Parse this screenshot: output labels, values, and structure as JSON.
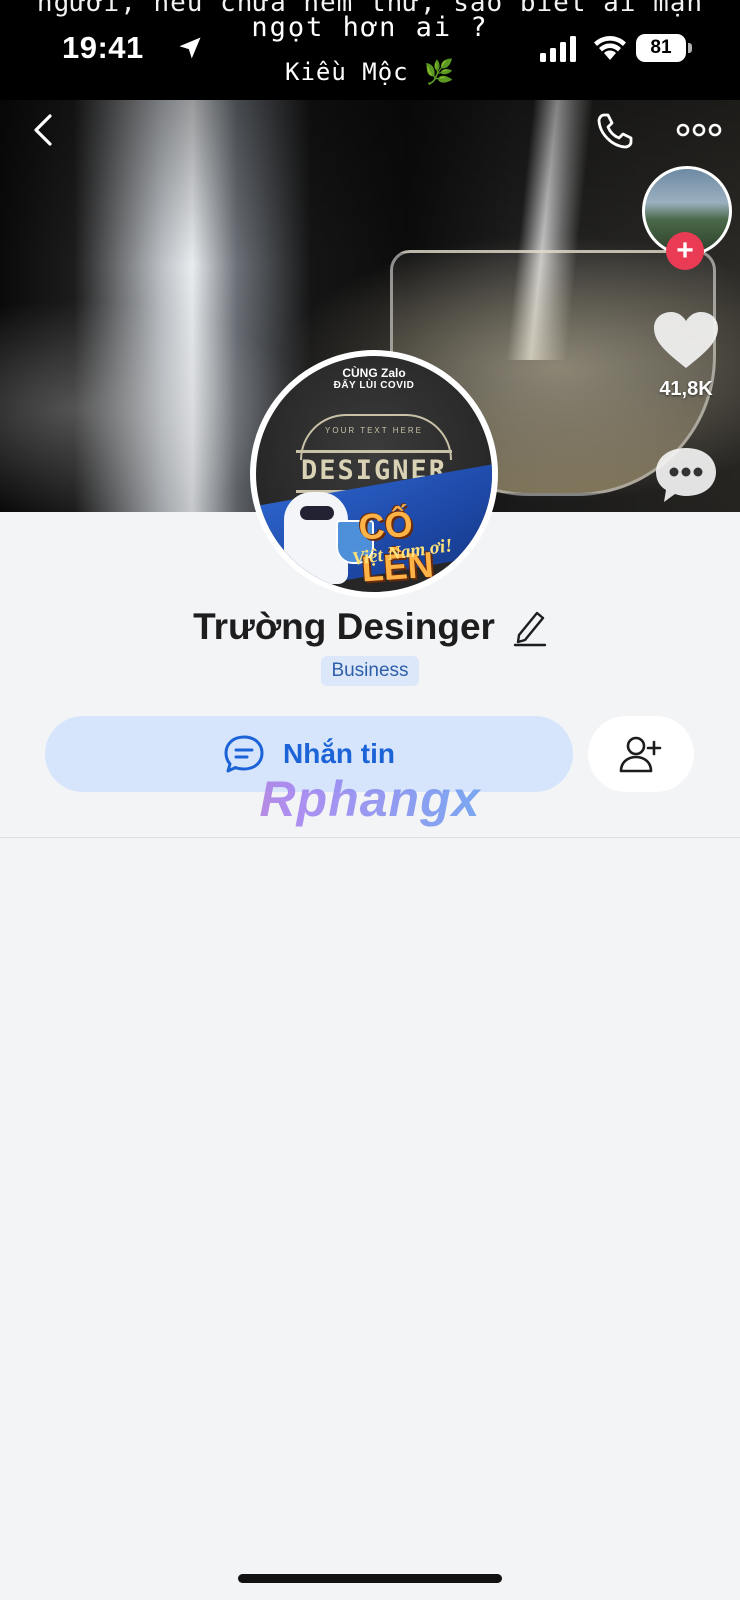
{
  "status_bar": {
    "time": "19:41",
    "battery": "81"
  },
  "overlay_caption": {
    "line1": "người, nếu chưa nếm thử, sao biết ai mặn",
    "line2": "ngọt hơn ai ?",
    "signature": "Kiều Mộc 🌿"
  },
  "cover": {
    "like_count": "41,8K"
  },
  "avatar": {
    "top_text1": "CÙNG Zalo",
    "top_text2": "ĐẨY LÙI COVID",
    "your_text": "YOUR TEXT HERE",
    "designer": "DESIGNER",
    "co_len": "CỐ LÊN",
    "viet_nam": "Việt Nam ơi!"
  },
  "profile": {
    "name": "Trường Desinger",
    "badge": "Business"
  },
  "actions": {
    "message_label": "Nhắn tin"
  },
  "watermark": "Rphangx",
  "colors": {
    "accent": "#1c63d8",
    "accent_bg": "#d6e5fb",
    "plus_red": "#ea3b55",
    "page_bg": "#f3f4f6"
  }
}
